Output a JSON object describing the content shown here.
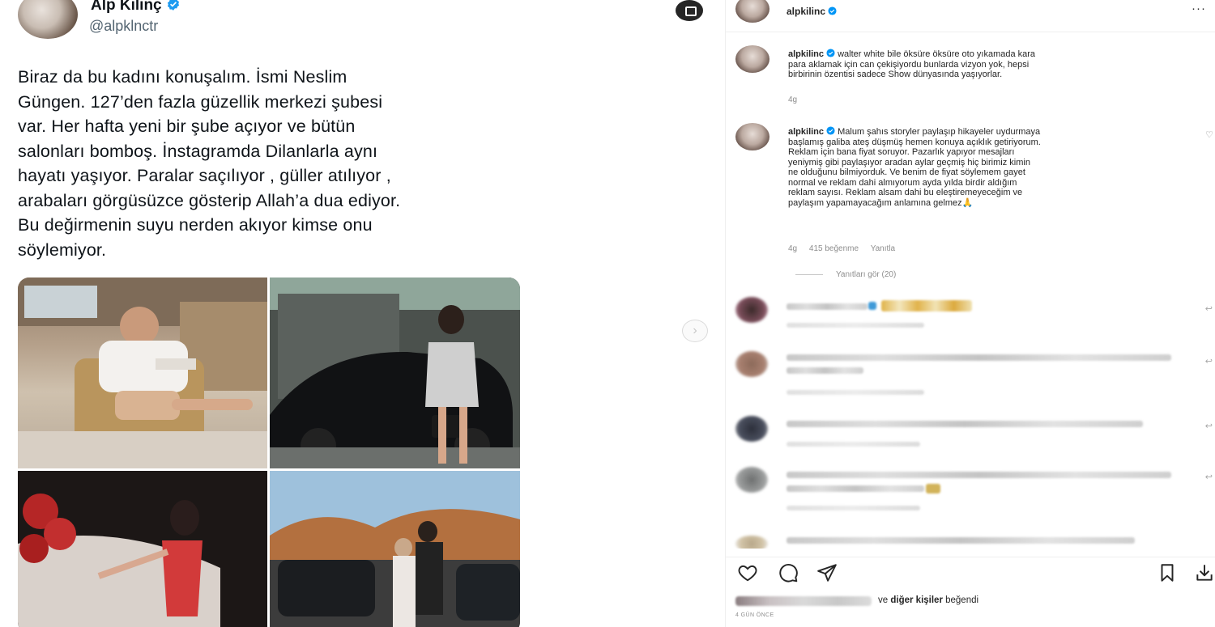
{
  "tweet": {
    "author_name": "Alp Kılınç",
    "author_handle": "@alpklnctr",
    "text_lines": [
      "Biraz da bu kadını konuşalım. İsmi Neslim",
      "Güngen. 127’den fazla güzellik merkezi şubesi",
      "var. Her hafta yeni bir şube açıyor ve bütün",
      "salonları bomboş. İnstagramda Dilanlarla aynı",
      "hayatı yaşıyor. Paralar saçılıyor , güller atılıyor ,",
      "arabaları görgüsüzce gösterip Allah’a dua ediyor.",
      "Bu değirmenin suyu nerden akıyor kimse onu",
      "söylemiyor."
    ],
    "verified_color": "#1d9bf0"
  },
  "instagram": {
    "header_username": "alpkilinc",
    "more_icon": "more-horizontal-icon",
    "caption1": {
      "username": "alpkilinc",
      "lines": [
        "walter white bile öksüre öksüre oto yıkamada kara",
        "para aklamak için can çekişiyordu bunlarda vizyon yok, hepsi",
        "birbirinin özentisi sadece Show dünyasında yaşıyorlar."
      ],
      "time": "4g"
    },
    "caption2": {
      "username": "alpkilinc",
      "lines": [
        "Malum şahıs storyler paylaşıp hikayeler uydurmaya",
        "başlamış galiba ateş düşmüş hemen konuya açıklık getiriyorum.",
        "Reklam için bana fiyat soruyor. Pazarlık yapıyor mesajları",
        "yeniymiş gibi paylaşıyor aradan aylar geçmiş hiç birimiz kimin",
        "ne olduğunu bilmiyorduk. Ve benim de fiyat söylemem gayet",
        "normal ve reklam dahi almıyorum ayda yılda birdir aldığım",
        "reklam sayısı. Reklam alsam dahi bu eleştiremeyeceğim ve",
        "paylaşım yapamayacağım anlamına gelmez🙏"
      ],
      "time": "4g",
      "likes": "415 beğenme",
      "reply": "Yanıtla"
    },
    "view_replies": "Yanıtları gör (20)",
    "likes_suffix_bold": "diğer kişiler",
    "likes_prefix": "ve",
    "likes_suffix": "beğendi",
    "post_date": "4 GÜN ÖNCE",
    "verified_color": "#0095f6"
  }
}
